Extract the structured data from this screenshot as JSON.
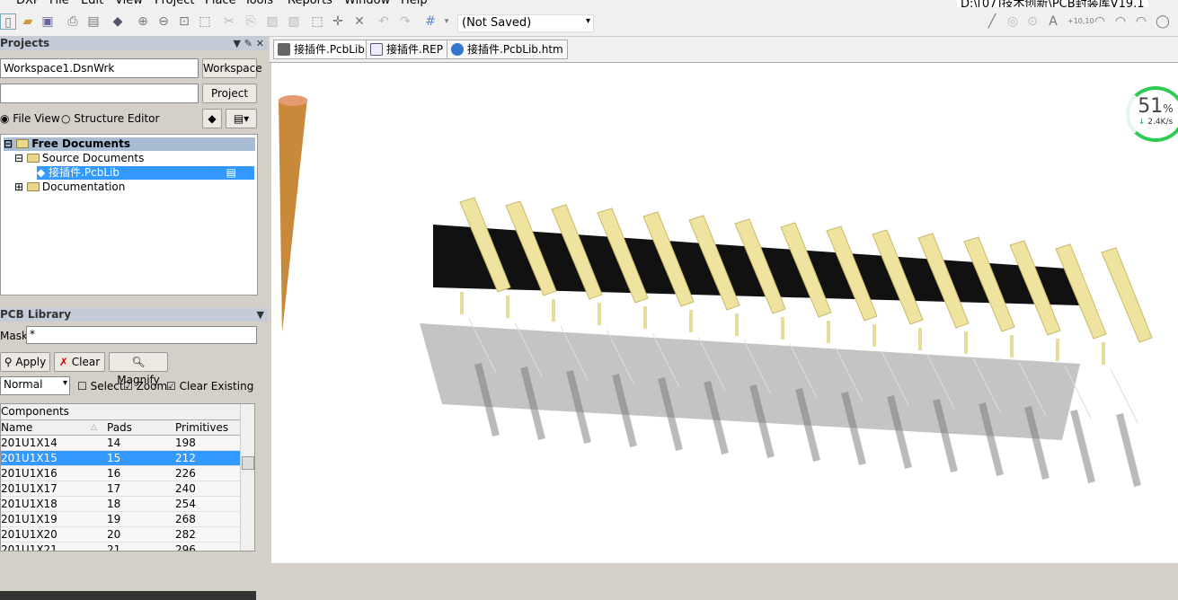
{
  "menu": [
    "DXP",
    "File",
    "Edit",
    "View",
    "Project",
    "Place",
    "Tools",
    "Reports",
    "Window",
    "Help"
  ],
  "title_path": "D:\\[07]技术创新\\PCB封装库V19.1",
  "toolbar": {
    "document_select": "(Not Saved)"
  },
  "projects_panel": {
    "title": "Projects",
    "workspace_value": "Workspace1.DsnWrk",
    "workspace_button": "Workspace",
    "project_value": "",
    "project_button": "Project",
    "file_view": "File View",
    "structure_editor": "Structure Editor",
    "tree": [
      {
        "label": "Free Documents",
        "level": 0
      },
      {
        "label": "Source Documents",
        "level": 1
      },
      {
        "label": "接插件.PcbLib",
        "level": 2,
        "selected": true
      },
      {
        "label": "Documentation",
        "level": 1
      }
    ]
  },
  "library_panel": {
    "title": "PCB Library",
    "mask_label": "Mask",
    "mask_value": "*",
    "apply": "Apply",
    "clear": "Clear",
    "magnify": "Magnify",
    "mode": "Normal",
    "select": "Select",
    "zoom": "Zoom",
    "clear_existing": "Clear Existing",
    "components_header": "Components",
    "columns": [
      "Name",
      "Pads",
      "Primitives"
    ],
    "rows": [
      [
        "201U1X14",
        "14",
        "198"
      ],
      [
        "201U1X15",
        "15",
        "212"
      ],
      [
        "201U1X16",
        "16",
        "226"
      ],
      [
        "201U1X17",
        "17",
        "240"
      ],
      [
        "201U1X18",
        "18",
        "254"
      ],
      [
        "201U1X19",
        "19",
        "268"
      ],
      [
        "201U1X20",
        "20",
        "282"
      ],
      [
        "201U1X21",
        "21",
        "296"
      ]
    ],
    "selected_row": 1
  },
  "tabs": [
    "接插件.PcbLib",
    "接插件.REP",
    "接插件.PcbLib.htm"
  ],
  "net_gauge": {
    "percent": "51",
    "unit": "%",
    "speed": "2.4K/s",
    "color": "#2ecc55"
  }
}
